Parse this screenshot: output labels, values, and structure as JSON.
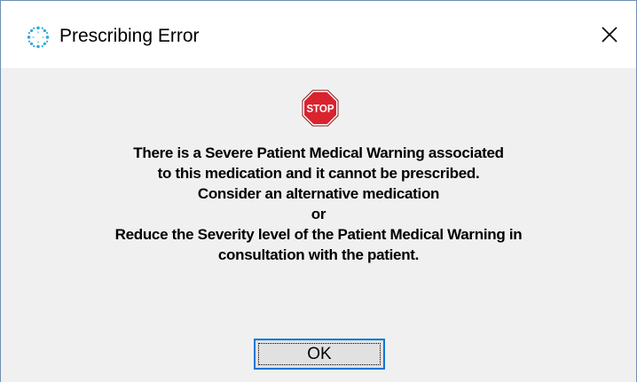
{
  "window": {
    "title": "Prescribing Error",
    "icon": "app-sparkle-icon",
    "close_icon": "close-icon"
  },
  "dialog": {
    "icon": "stop-sign-icon",
    "icon_label": "STOP",
    "message_lines": [
      "There is a Severe Patient Medical Warning associated",
      "to this medication and it cannot be prescribed.",
      "Consider an alternative medication",
      "or",
      "Reduce the Severity level of the Patient Medical Warning in",
      "consultation with the patient."
    ],
    "ok_label": "OK"
  },
  "colors": {
    "stop_red": "#d9232e",
    "focus_border": "#0078d7",
    "button_face": "#e1e1e1",
    "dialog_background": "#f0f0f0"
  }
}
